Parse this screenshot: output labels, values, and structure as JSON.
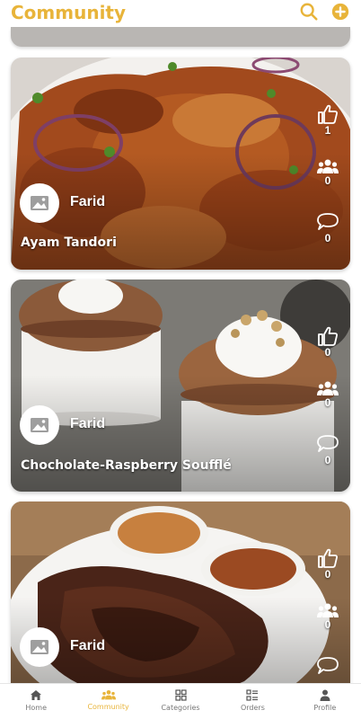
{
  "header": {
    "title": "Community",
    "search_icon": "search-icon",
    "add_icon": "add-circle-icon",
    "accent_color": "#e8b43a"
  },
  "posts": [
    {
      "author": "Farid",
      "dish": "Ayam Tandori",
      "likes": "1",
      "group_count": "0",
      "comments": "0",
      "image": "grilled-chicken-photo"
    },
    {
      "author": "Farid",
      "dish": "Chocholate-Raspberry Soufflé",
      "likes": "0",
      "group_count": "0",
      "comments": "0",
      "image": "souffle-photo"
    },
    {
      "author": "Farid",
      "dish": "",
      "likes": "0",
      "group_count": "0",
      "comments": "",
      "image": "grilled-meat-photo"
    }
  ],
  "tabs": [
    {
      "label": "Home",
      "icon": "home-icon",
      "active": false
    },
    {
      "label": "Community",
      "icon": "community-icon",
      "active": true
    },
    {
      "label": "Categories",
      "icon": "grid-icon",
      "active": false
    },
    {
      "label": "Orders",
      "icon": "list-icon",
      "active": false
    },
    {
      "label": "Profile",
      "icon": "person-icon",
      "active": false
    }
  ]
}
